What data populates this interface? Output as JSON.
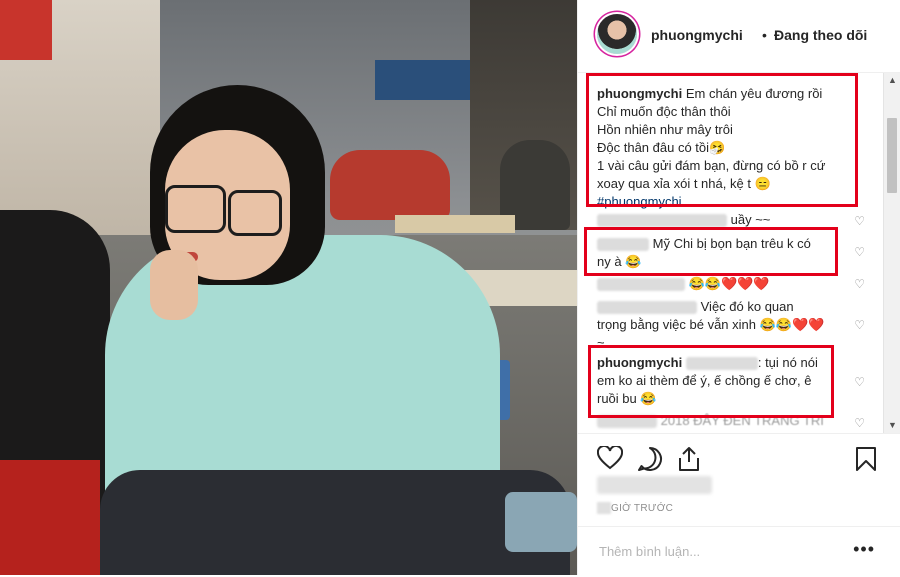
{
  "post": {
    "username": "phuongmychi",
    "separator": "•",
    "follow_status": "Đang theo dõi"
  },
  "caption": {
    "username": "phuongmychi",
    "lines": [
      "Em chán yêu đương rồi",
      "Chỉ muốn độc thân thôi",
      "Hồn nhiên như mây trôi",
      "Độc thân đâu có tồi🤧",
      "1 vài câu gửi đám bạn, đừng có bồ r cứ",
      "xoay qua xỉa xói t nhá, kệ t 😑",
      "#phuongmychi"
    ]
  },
  "comments": [
    {
      "text_tail": "uầy ~~"
    },
    {
      "text_line1": "Mỹ Chi bị bọn bạn trêu k có",
      "text_line2": "ny à 😂"
    },
    {
      "text_tail": "😂😂❤️❤️❤️"
    },
    {
      "text_line1": "Việc đó ko quan",
      "text_line2": "trọng bằng việc bé vẫn xinh 😂😂❤️❤️",
      "text_line3": "~"
    },
    {
      "username": "phuongmychi",
      "text_line1": ": tụi nó nói",
      "text_line2": "em ko ai thèm để ý, ế chồng ế chơ, ê",
      "text_line3": "ruồi bu 😂"
    },
    {
      "text_tail": "2018 ĐÂY ĐEN TRANG TRI"
    }
  ],
  "footer": {
    "time_label": "GIỜ TRƯỚC",
    "add_comment_placeholder": "Thêm bình luận...",
    "more_label": "•••"
  },
  "icons": {
    "like": "heart-outline-icon",
    "comment": "speech-bubble-icon",
    "share": "share-icon",
    "save": "bookmark-icon"
  },
  "colors": {
    "highlight_box": "#e3001b",
    "story_ring": "#d6249f"
  }
}
